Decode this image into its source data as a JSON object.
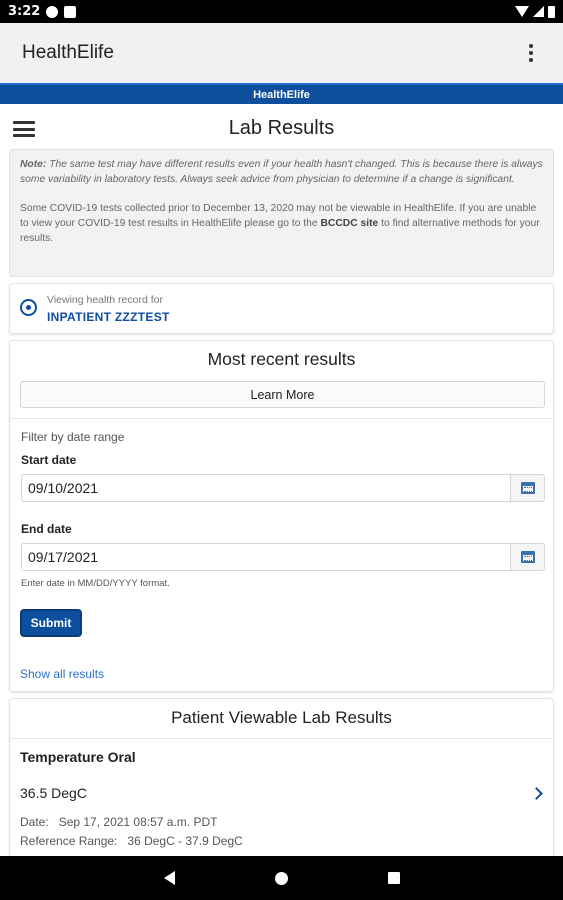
{
  "status_bar": {
    "time": "3:22",
    "left_icons": [
      "shield-g-icon",
      "sd-card-icon"
    ],
    "right_icons": [
      "wifi-icon",
      "signal-icon",
      "battery-icon"
    ]
  },
  "app_bar": {
    "title": "HealthElife",
    "overflow_icon": "more-vert-icon"
  },
  "banner": {
    "text": "HealthElife",
    "color": "#0d4f9c"
  },
  "page": {
    "title": "Lab Results",
    "menu_icon": "hamburger-icon"
  },
  "note": {
    "label": "Note:",
    "text": " The same test may have different results even if your health hasn't changed. This is because there is always some variability in laboratory tests. Always seek advice from physician to determine if a change is significant.",
    "covid_text_1": "Some COVID-19 tests collected prior to December 13, 2020 may not be viewable in HealthElife. If you are unable to view your COVID-19 test results in HealthElife please go to the ",
    "covid_link": "BCCDC site",
    "covid_text_2": " to find alternative methods for your results."
  },
  "record": {
    "label": "Viewing health record for",
    "name": "INPATIENT ZZZTEST",
    "icon": "user-circle-icon"
  },
  "recent": {
    "title": "Most recent results",
    "learn_more": "Learn More",
    "filter_label": "Filter by date range",
    "start_label": "Start date",
    "start_value": "09/10/2021",
    "end_label": "End date",
    "end_value": "09/17/2021",
    "hint": "Enter date in MM/DD/YYYY format.",
    "submit": "Submit",
    "show_all": "Show all results"
  },
  "patient_results": {
    "title": "Patient Viewable Lab Results",
    "items": [
      {
        "name": "Temperature Oral",
        "value": "36.5 DegC",
        "date_label": "Date:",
        "date": "Sep 17, 2021 08:57 a.m. PDT",
        "range_label": "Reference Range:",
        "range": "36 DegC - 37.9 DegC"
      }
    ]
  },
  "nav_bar": {
    "icons": [
      "back-icon",
      "home-icon",
      "recents-icon"
    ]
  }
}
